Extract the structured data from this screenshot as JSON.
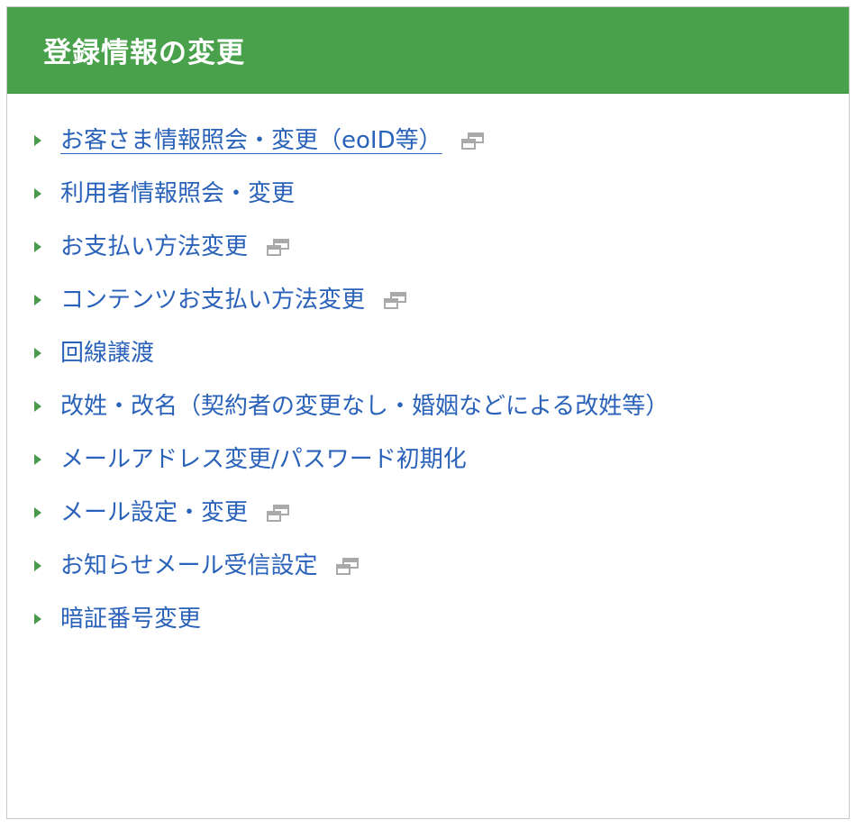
{
  "panel": {
    "title": "登録情報の変更",
    "header_color": "#49a14c",
    "link_color": "#2a62b9"
  },
  "links": [
    {
      "label": "お客さま情報照会・変更（eoID等）",
      "icon": "new-window-icon"
    },
    {
      "label": "利用者情報照会・変更",
      "icon": ""
    },
    {
      "label": "お支払い方法変更",
      "icon": "new-window-icon"
    },
    {
      "label": "コンテンツお支払い方法変更",
      "icon": "new-window-icon"
    },
    {
      "label": "回線譲渡",
      "icon": ""
    },
    {
      "label": "改姓・改名（契約者の変更なし・婚姻などによる改姓等）",
      "icon": ""
    },
    {
      "label": "メールアドレス変更/パスワード初期化",
      "icon": ""
    },
    {
      "label": "メール設定・変更",
      "icon": "new-window-icon"
    },
    {
      "label": "お知らせメール受信設定",
      "icon": "new-window-icon"
    },
    {
      "label": "暗証番号変更",
      "icon": ""
    }
  ]
}
